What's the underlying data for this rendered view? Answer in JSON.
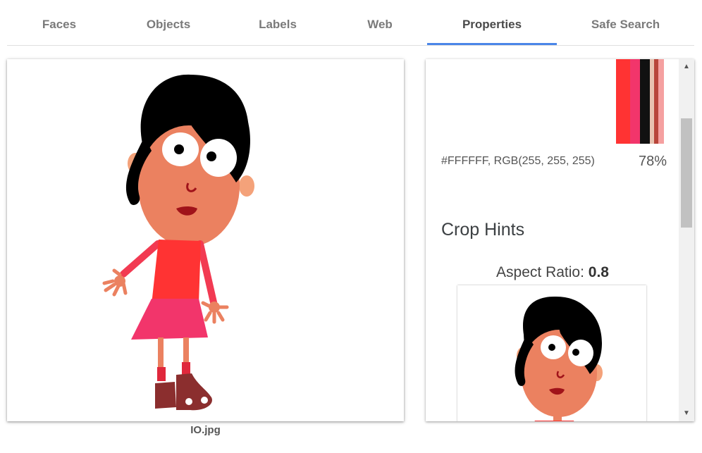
{
  "tabs": [
    {
      "label": "Faces"
    },
    {
      "label": "Objects"
    },
    {
      "label": "Labels"
    },
    {
      "label": "Web"
    },
    {
      "label": "Properties"
    },
    {
      "label": "Safe Search"
    }
  ],
  "active_tab": "Properties",
  "image": {
    "filename": "IO.jpg"
  },
  "properties": {
    "dominant_colors": [
      {
        "hex": "#FF3333"
      },
      {
        "hex": "#F2356B"
      },
      {
        "hex": "#111111"
      },
      {
        "hex": "#E8C2B0"
      },
      {
        "hex": "#B8453A"
      },
      {
        "hex": "#F5A0A0"
      }
    ],
    "color_text": "#FFFFFF,  RGB(255, 255, 255)",
    "color_percent": "78%",
    "crop_hints_title": "Crop Hints",
    "aspect_label": "Aspect Ratio: ",
    "aspect_value": "0.8"
  },
  "colors": {
    "accent": "#4a86e8"
  }
}
